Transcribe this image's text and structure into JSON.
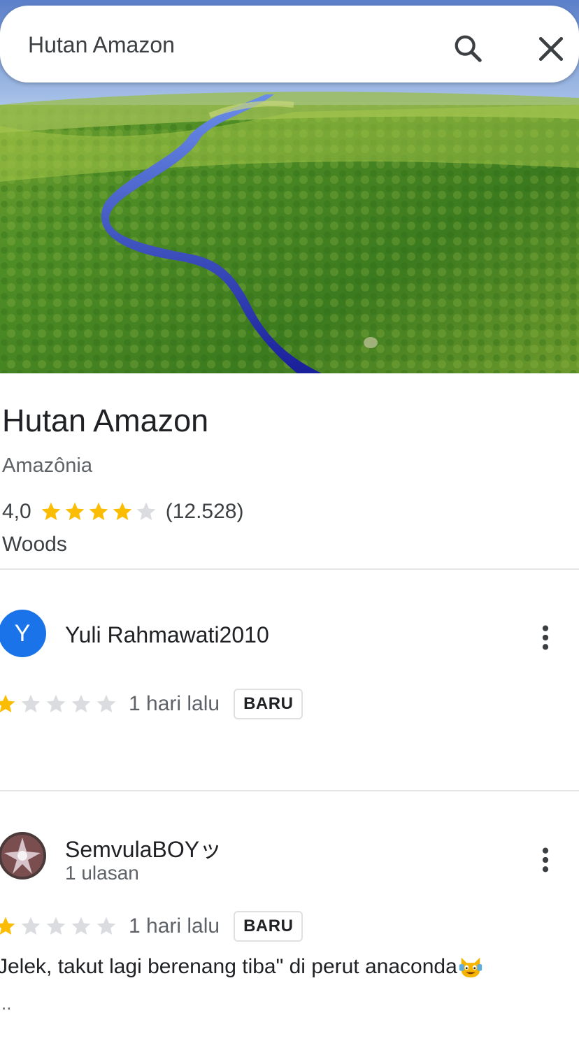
{
  "search": {
    "query": "Hutan Amazon"
  },
  "place": {
    "title": "Hutan Amazon",
    "subtitle": "Amazônia",
    "rating": "4,0",
    "rating_stars": 4,
    "review_count": "(12.528)",
    "category": "Woods"
  },
  "reviews": [
    {
      "avatar_letter": "Y",
      "name": "Yuli Rahmawati2010",
      "stars": 1,
      "date": "1 hari lalu",
      "badge": "BARU"
    },
    {
      "name": "SemvulaBOYッ",
      "meta": "1 ulasan",
      "stars": 1,
      "date": "1 hari lalu",
      "badge": "BARU",
      "text": "Jelek, takut lagi berenang tiba\" di perut anaconda",
      "more": ".."
    }
  ],
  "colors": {
    "star_filled": "#fbbc04",
    "star_empty": "#dadce0",
    "avatar_blue": "#1a73e8"
  }
}
